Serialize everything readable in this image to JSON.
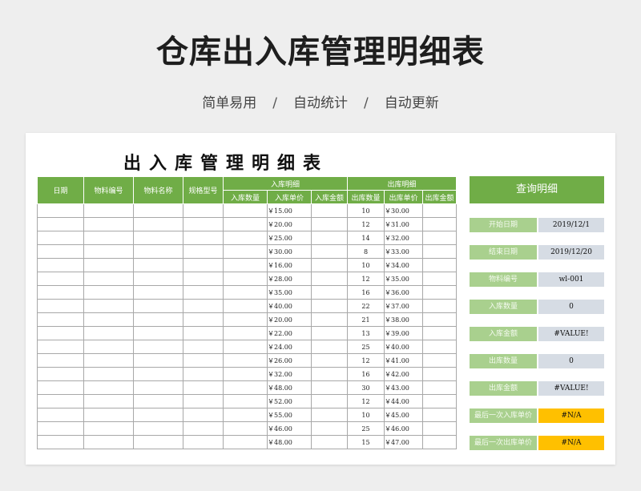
{
  "header": {
    "title": "仓库出入库管理明细表",
    "subtitle": [
      "简单易用",
      "自动统计",
      "自动更新"
    ],
    "separator": "/"
  },
  "sheet": {
    "title": "出入库管理明细表",
    "columns": {
      "date": "日期",
      "item_code": "物料编号",
      "item_name": "物料名称",
      "spec": "规格型号",
      "in_group": "入库明细",
      "in_qty": "入库数量",
      "in_price": "入库单价",
      "in_amount": "入库金额",
      "out_group": "出库明细",
      "out_qty": "出库数量",
      "out_price": "出库单价",
      "out_amount": "出库金额"
    },
    "rows": [
      {
        "in_price": "￥15.00",
        "out_qty": "10",
        "out_price": "￥30.00"
      },
      {
        "in_price": "￥20.00",
        "out_qty": "12",
        "out_price": "￥31.00"
      },
      {
        "in_price": "￥25.00",
        "out_qty": "14",
        "out_price": "￥32.00"
      },
      {
        "in_price": "￥30.00",
        "out_qty": "8",
        "out_price": "￥33.00"
      },
      {
        "in_price": "￥16.00",
        "out_qty": "10",
        "out_price": "￥34.00"
      },
      {
        "in_price": "￥28.00",
        "out_qty": "12",
        "out_price": "￥35.00"
      },
      {
        "in_price": "￥35.00",
        "out_qty": "16",
        "out_price": "￥36.00"
      },
      {
        "in_price": "￥40.00",
        "out_qty": "22",
        "out_price": "￥37.00"
      },
      {
        "in_price": "￥20.00",
        "out_qty": "21",
        "out_price": "￥38.00"
      },
      {
        "in_price": "￥22.00",
        "out_qty": "13",
        "out_price": "￥39.00"
      },
      {
        "in_price": "￥24.00",
        "out_qty": "25",
        "out_price": "￥40.00"
      },
      {
        "in_price": "￥26.00",
        "out_qty": "12",
        "out_price": "￥41.00"
      },
      {
        "in_price": "￥32.00",
        "out_qty": "16",
        "out_price": "￥42.00"
      },
      {
        "in_price": "￥48.00",
        "out_qty": "30",
        "out_price": "￥43.00"
      },
      {
        "in_price": "￥52.00",
        "out_qty": "12",
        "out_price": "￥44.00"
      },
      {
        "in_price": "￥55.00",
        "out_qty": "10",
        "out_price": "￥45.00"
      },
      {
        "in_price": "￥46.00",
        "out_qty": "25",
        "out_price": "￥46.00"
      },
      {
        "in_price": "￥48.00",
        "out_qty": "15",
        "out_price": "￥47.00"
      }
    ]
  },
  "query": {
    "title": "查询明细",
    "fields": [
      {
        "label": "开始日期",
        "value": "2019/12/1",
        "style": "normal"
      },
      {
        "label": "结束日期",
        "value": "2019/12/20",
        "style": "normal"
      },
      {
        "label": "物料编号",
        "value": "wl-001",
        "style": "normal"
      },
      {
        "label": "入库数量",
        "value": "0",
        "style": "normal"
      },
      {
        "label": "入库金额",
        "value": "#VALUE!",
        "style": "normal"
      },
      {
        "label": "出库数量",
        "value": "0",
        "style": "normal"
      },
      {
        "label": "出库金额",
        "value": "#VALUE!",
        "style": "normal"
      },
      {
        "label": "最后一次入库单价",
        "value": "#N/A",
        "style": "warn"
      },
      {
        "label": "最后一次出库单价",
        "value": "#N/A",
        "style": "warn"
      }
    ],
    "colors": {
      "header": "#70ad47",
      "label": "#a9d08e",
      "value": "#d6dce4",
      "warn": "#ffc000"
    }
  }
}
